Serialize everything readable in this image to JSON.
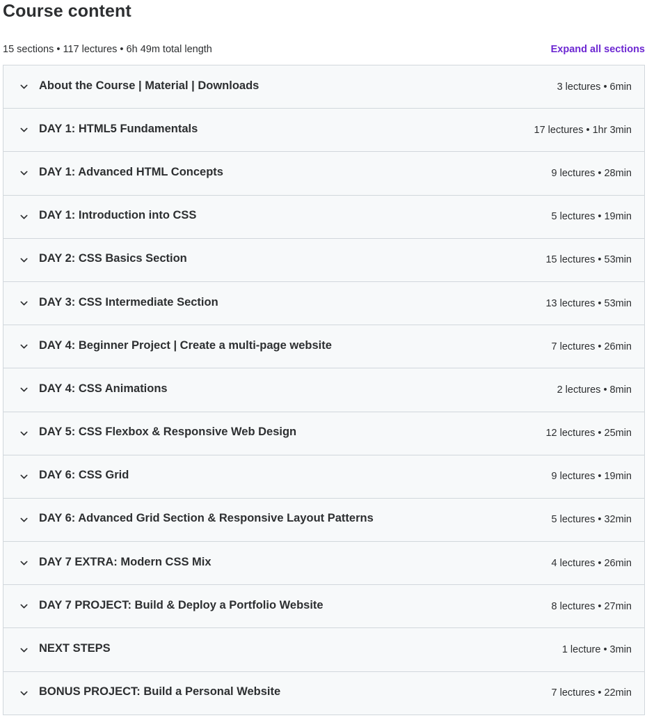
{
  "header": {
    "title": "Course content",
    "summary": "15 sections • 117 lectures • 6h 49m total length",
    "expand_label": "Expand all sections"
  },
  "colors": {
    "accent": "#6d28d2",
    "text": "#2d2f31",
    "row_bg": "#f7f9fa",
    "border": "#d1d7dc"
  },
  "icons": {
    "row_toggle": "chevron-down-icon"
  },
  "sections": [
    {
      "title": "About the Course | Material | Downloads",
      "meta": "3 lectures • 6min"
    },
    {
      "title": "DAY 1: HTML5 Fundamentals",
      "meta": "17 lectures • 1hr 3min"
    },
    {
      "title": "DAY 1: Advanced HTML Concepts",
      "meta": "9 lectures • 28min"
    },
    {
      "title": "DAY 1: Introduction into CSS",
      "meta": "5 lectures • 19min"
    },
    {
      "title": "DAY 2: CSS Basics Section",
      "meta": "15 lectures • 53min"
    },
    {
      "title": "DAY 3: CSS Intermediate Section",
      "meta": "13 lectures • 53min"
    },
    {
      "title": "DAY 4: Beginner Project | Create a multi-page website",
      "meta": "7 lectures • 26min"
    },
    {
      "title": "DAY 4: CSS Animations",
      "meta": "2 lectures • 8min"
    },
    {
      "title": "DAY 5: CSS Flexbox & Responsive Web Design",
      "meta": "12 lectures • 25min"
    },
    {
      "title": "DAY 6: CSS Grid",
      "meta": "9 lectures • 19min"
    },
    {
      "title": "DAY 6: Advanced Grid Section & Responsive Layout Patterns",
      "meta": "5 lectures • 32min"
    },
    {
      "title": "DAY 7 EXTRA: Modern CSS Mix",
      "meta": "4 lectures • 26min"
    },
    {
      "title": "DAY 7 PROJECT: Build & Deploy a Portfolio Website",
      "meta": "8 lectures • 27min"
    },
    {
      "title": "NEXT STEPS",
      "meta": "1 lecture • 3min"
    },
    {
      "title": "BONUS PROJECT: Build a Personal Website",
      "meta": "7 lectures • 22min"
    }
  ]
}
